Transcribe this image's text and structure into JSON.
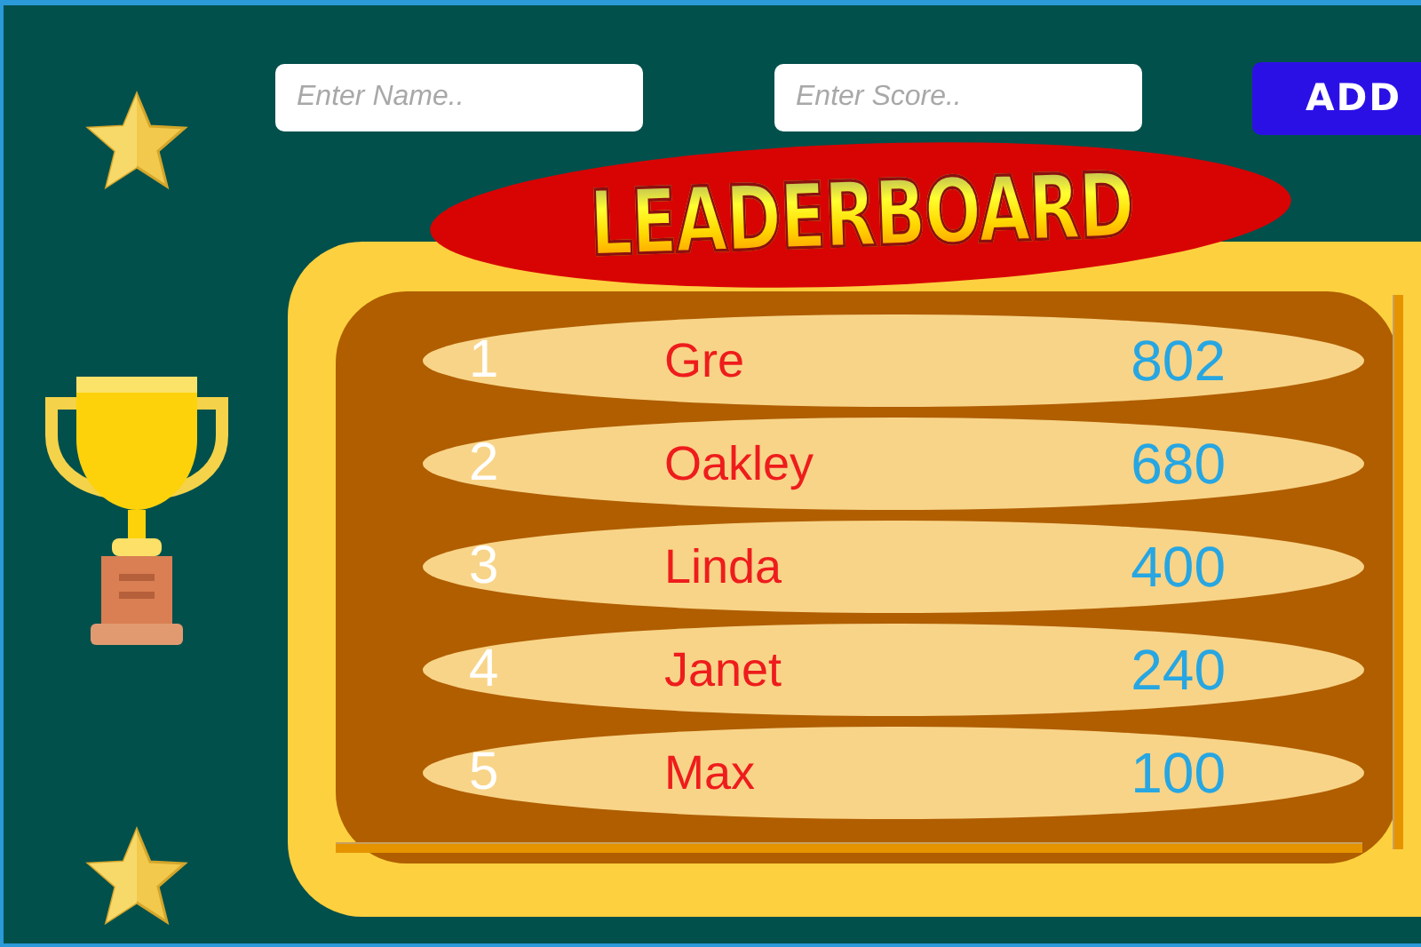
{
  "form": {
    "name_field": {
      "placeholder": "Enter Name.."
    },
    "score_field": {
      "placeholder": "Enter Score.."
    },
    "add_button": "ADD"
  },
  "title": "LEADERBOARD",
  "entries": [
    {
      "rank": "1",
      "name": "Gre",
      "score": "802"
    },
    {
      "rank": "2",
      "name": "Oakley",
      "score": "680"
    },
    {
      "rank": "3",
      "name": "Linda",
      "score": "400"
    },
    {
      "rank": "4",
      "name": "Janet",
      "score": "240"
    },
    {
      "rank": "5",
      "name": "Max",
      "score": "100"
    }
  ]
}
